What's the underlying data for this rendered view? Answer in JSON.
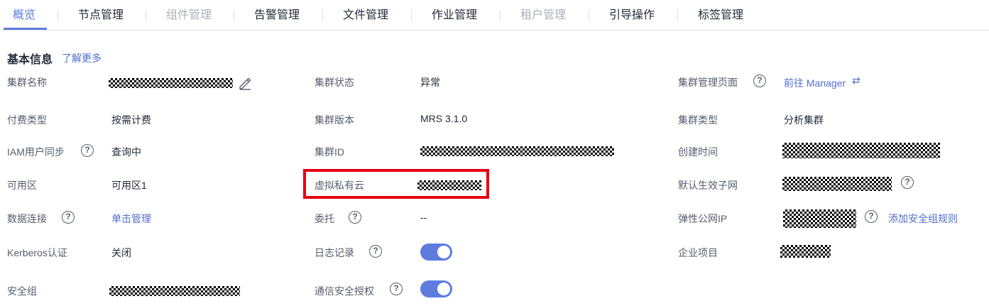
{
  "tabs": [
    {
      "label": "概览",
      "state": "active"
    },
    {
      "label": "节点管理",
      "state": "normal"
    },
    {
      "label": "组件管理",
      "state": "disabled"
    },
    {
      "label": "告警管理",
      "state": "normal"
    },
    {
      "label": "文件管理",
      "state": "normal"
    },
    {
      "label": "作业管理",
      "state": "normal"
    },
    {
      "label": "租户管理",
      "state": "disabled"
    },
    {
      "label": "引导操作",
      "state": "normal"
    },
    {
      "label": "标签管理",
      "state": "normal"
    }
  ],
  "section": {
    "title": "基本信息",
    "learn_more": "了解更多"
  },
  "fields": {
    "cluster_name": {
      "label": "集群名称"
    },
    "cluster_status": {
      "label": "集群状态",
      "value": "异常"
    },
    "cluster_manager_page": {
      "label": "集群管理页面",
      "link": "前往 Manager"
    },
    "billing_type": {
      "label": "付费类型",
      "value": "按需计费"
    },
    "cluster_version": {
      "label": "集群版本",
      "value": "MRS 3.1.0"
    },
    "cluster_type": {
      "label": "集群类型",
      "value": "分析集群"
    },
    "iam_sync": {
      "label": "IAM用户同步",
      "value": "查询中"
    },
    "cluster_id": {
      "label": "集群ID"
    },
    "create_time": {
      "label": "创建时间"
    },
    "az": {
      "label": "可用区",
      "value": "可用区1"
    },
    "vpc": {
      "label": "虚拟私有云"
    },
    "default_subnet": {
      "label": "默认生效子网"
    },
    "data_connection": {
      "label": "数据连接",
      "link": "单击管理"
    },
    "agency": {
      "label": "委托",
      "value": "--"
    },
    "eip": {
      "label": "弹性公网IP",
      "link": "添加安全组规则"
    },
    "kerberos": {
      "label": "Kerberos认证",
      "value": "关闭"
    },
    "logging": {
      "label": "日志记录",
      "enabled": true
    },
    "enterprise_project": {
      "label": "企业项目"
    },
    "security_group": {
      "label": "安全组"
    },
    "comm_security": {
      "label": "通信安全授权",
      "enabled": true
    }
  },
  "icons": {
    "help": "?",
    "swap": "⇄"
  },
  "colors": {
    "accent": "#5e7ce0",
    "link": "#526ecc",
    "highlight": "#e60012"
  }
}
